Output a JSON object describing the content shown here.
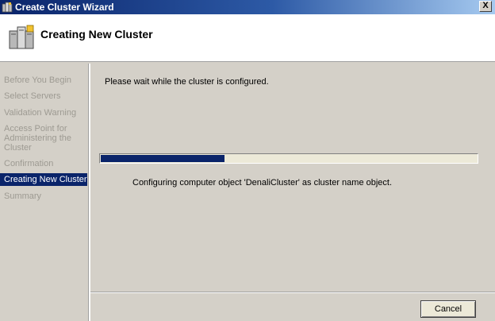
{
  "window": {
    "title": "Create Cluster Wizard",
    "icon": "cluster-servers-icon",
    "close_label": "X"
  },
  "header": {
    "title": "Creating New Cluster",
    "icon": "cluster-servers-icon"
  },
  "nav": {
    "items": [
      {
        "label": "Before You Begin",
        "active": false
      },
      {
        "label": "Select Servers",
        "active": false
      },
      {
        "label": "Validation Warning",
        "active": false
      },
      {
        "label": "Access Point for",
        "active": false
      },
      {
        "label": "Administering the",
        "active": false
      },
      {
        "label": "Cluster",
        "active": false
      },
      {
        "label": "Confirmation",
        "active": false
      },
      {
        "label": "Creating New Cluster",
        "active": true
      },
      {
        "label": "Summary",
        "active": false
      }
    ]
  },
  "main": {
    "wait_text": "Please wait while the cluster is configured.",
    "progress": 0.33,
    "status_text": "Configuring computer object 'DenaliCluster' as cluster name object."
  },
  "footer": {
    "cancel_label": "Cancel"
  },
  "colors": {
    "title_bar_start": "#0a246a",
    "title_bar_end": "#a6caf0",
    "selection": "#0a246a",
    "dialog_background": "#d4d0c8",
    "disabled_text": "#9d9a92",
    "progress_fill": "#0a246a"
  }
}
